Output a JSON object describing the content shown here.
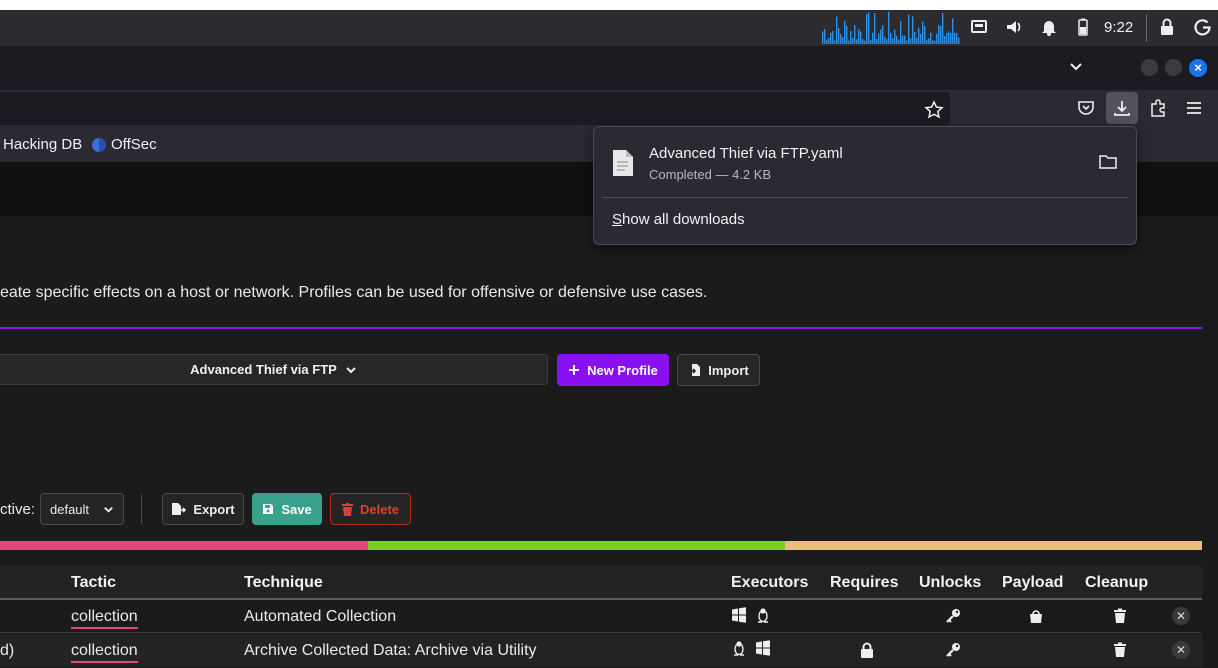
{
  "system_bar": {
    "clock": "9:22"
  },
  "bookmarks": {
    "items": [
      "Hacking DB",
      "OffSec"
    ]
  },
  "download_panel": {
    "file_name": "Advanced Thief via FTP.yaml",
    "status": "Completed — 4.2 KB",
    "show_all_first": "S",
    "show_all_rest": "how all downloads"
  },
  "page": {
    "description": "eate specific effects on a host or network. Profiles can be used for offensive or defensive use cases.",
    "profile_selected": "Advanced Thief via FTP",
    "new_profile_label": "New Profile",
    "import_label": "Import",
    "active_label": "ctive:",
    "adversary_value": "default",
    "export_label": "Export",
    "save_label": "Save",
    "delete_label": "Delete",
    "tactic_bar_colors": [
      "#e0487a",
      "#7ccf22",
      "#e8c07c"
    ],
    "tactic_bar_fractions": [
      0.306,
      0.347,
      0.347
    ]
  },
  "table": {
    "headers": {
      "tactic": "Tactic",
      "technique": "Technique",
      "executors": "Executors",
      "requires": "Requires",
      "unlocks": "Unlocks",
      "payload": "Payload",
      "cleanup": "Cleanup"
    },
    "rows": [
      {
        "name": "",
        "tactic": "collection",
        "technique": "Automated Collection",
        "executors": [
          "windows-icon",
          "linux-icon"
        ],
        "requires": false,
        "unlocks": true,
        "payload": true,
        "cleanup": true
      },
      {
        "name": "d)",
        "tactic": "collection",
        "technique": "Archive Collected Data: Archive via Utility",
        "executors": [
          "linux-icon",
          "windows-icon"
        ],
        "requires": true,
        "unlocks": true,
        "payload": false,
        "cleanup": true
      }
    ]
  },
  "colors": {
    "accent_purple": "#8a0ff2",
    "save_green": "#3aa28c",
    "delete_red": "#c2261a",
    "tactic_underline": "#e0487a"
  }
}
